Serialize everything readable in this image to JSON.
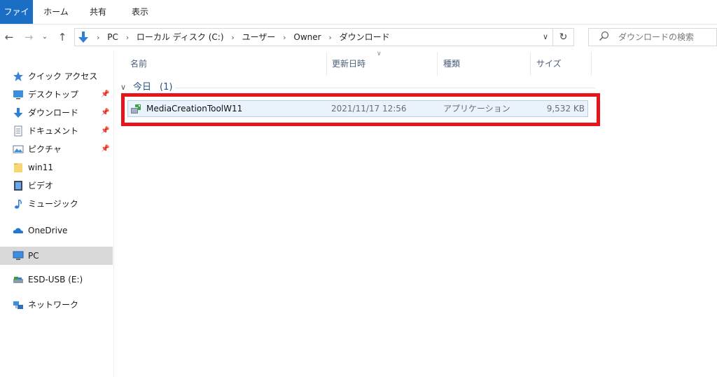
{
  "ribbon": {
    "tabs": [
      {
        "label": "ファイル"
      },
      {
        "label": "ホーム"
      },
      {
        "label": "共有"
      },
      {
        "label": "表示"
      }
    ]
  },
  "navigation": {
    "breadcrumb": [
      "PC",
      "ローカル ディスク (C:)",
      "ユーザー",
      "Owner",
      "ダウンロード"
    ],
    "search_placeholder": "ダウンロードの検索"
  },
  "sidebar": {
    "quick_access": {
      "label": "クイック アクセス"
    },
    "items": [
      {
        "label": "デスクトップ",
        "icon": "desktop-icon",
        "pinned": true
      },
      {
        "label": "ダウンロード",
        "icon": "download-icon",
        "pinned": true
      },
      {
        "label": "ドキュメント",
        "icon": "documents-icon",
        "pinned": true
      },
      {
        "label": "ピクチャ",
        "icon": "pictures-icon",
        "pinned": true
      },
      {
        "label": "win11",
        "icon": "folder-icon",
        "pinned": false
      },
      {
        "label": "ビデオ",
        "icon": "videos-icon",
        "pinned": false
      },
      {
        "label": "ミュージック",
        "icon": "music-icon",
        "pinned": false
      }
    ],
    "onedrive": {
      "label": "OneDrive"
    },
    "pc": {
      "label": "PC"
    },
    "usb": {
      "label": "ESD-USB (E:)"
    },
    "network": {
      "label": "ネットワーク"
    }
  },
  "columns": {
    "name": "名前",
    "modified": "更新日時",
    "type": "種類",
    "size": "サイズ"
  },
  "group": {
    "label": "今日",
    "count": "(1)"
  },
  "files": [
    {
      "name": "MediaCreationToolW11",
      "modified": "2021/11/17 12:56",
      "type": "アプリケーション",
      "size": "9,532 KB"
    }
  ],
  "colors": {
    "file_tab": "#1a6fc4",
    "selection_bg": "#eaf2fb",
    "highlight_border": "#e8141b",
    "sidebar_selected": "#d9d9d9"
  }
}
